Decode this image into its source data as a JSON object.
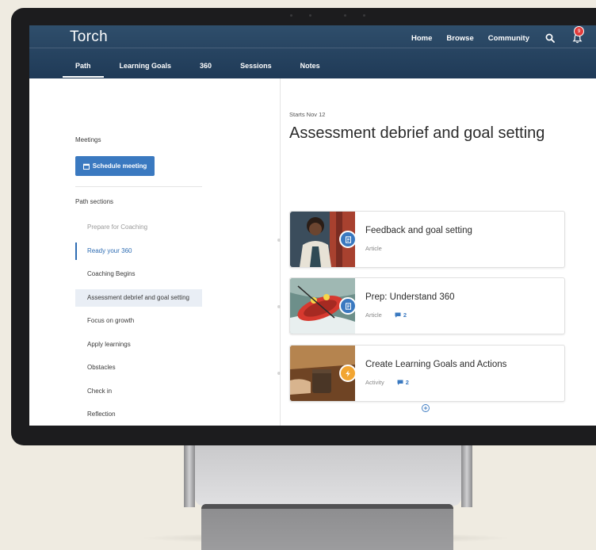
{
  "app": {
    "brand": "Torch"
  },
  "header": {
    "nav": [
      "Home",
      "Browse",
      "Community"
    ],
    "notification_count": "9"
  },
  "tabs": [
    "Path",
    "Learning Goals",
    "360",
    "Sessions",
    "Notes"
  ],
  "left": {
    "meetings_label": "Meetings",
    "schedule_button": "Schedule meeting",
    "path_sections_label": "Path sections",
    "sections": [
      "Prepare for Coaching",
      "Ready your 360",
      "Coaching Begins",
      "Assessment debrief and goal setting",
      "Focus on growth",
      "Apply learnings",
      "Obstacles",
      "Check in",
      "Reflection"
    ]
  },
  "main": {
    "starts": "Starts Nov 12",
    "title": "Assessment debrief and goal setting",
    "cards": [
      {
        "title": "Feedback and goal setting",
        "type": "Article",
        "comments": ""
      },
      {
        "title": "Prep: Understand 360",
        "type": "Article",
        "comments": "2"
      },
      {
        "title": "Create Learning Goals and Actions",
        "type": "Activity",
        "comments": "2"
      }
    ]
  },
  "colors": {
    "header": "#2f4e6b",
    "accent": "#3a79c0",
    "activity": "#f2a531",
    "selected_bg": "#e9eef5"
  }
}
